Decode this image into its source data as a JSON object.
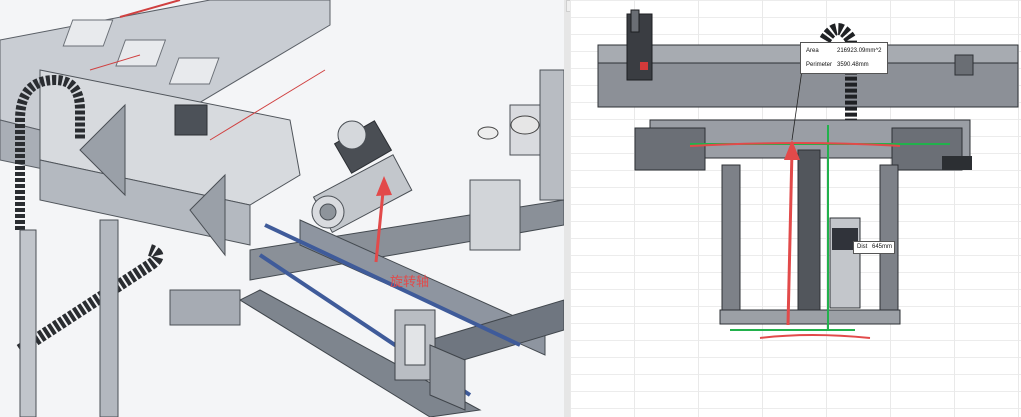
{
  "left_view": {
    "annotation_text": "旋转轴",
    "annotation_color": "#e24a4a"
  },
  "right_view": {
    "measure_tooltip": {
      "area_label": "Area",
      "area_value": "216923.09mm^2",
      "perimeter_label": "Perimeter",
      "perimeter_value": "3590.48mm"
    },
    "distance_tooltip": {
      "label": "Dist",
      "value": "645mm"
    },
    "sketch_color": "#e24a4a",
    "measure_line_color": "#22b14c"
  },
  "splitter": {
    "collapse_glyph": "▲"
  },
  "icons": [
    "chevron-up-icon",
    "ruler-icon"
  ]
}
